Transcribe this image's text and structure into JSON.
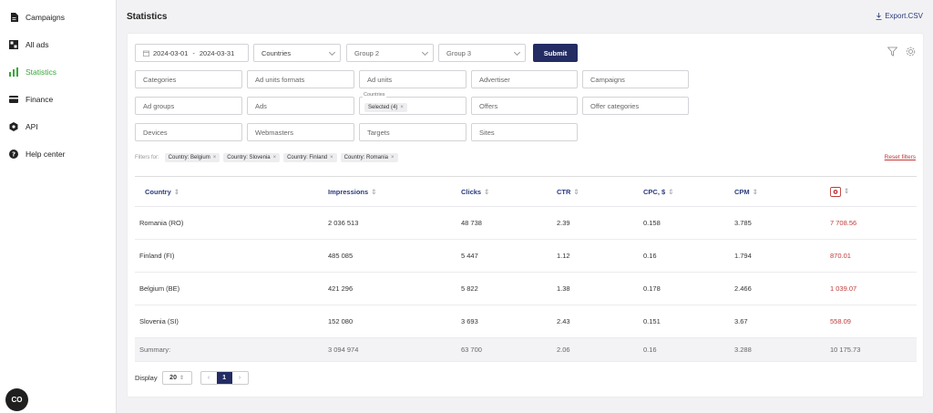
{
  "sidebar": {
    "items": [
      {
        "label": "Campaigns",
        "icon": "document-icon"
      },
      {
        "label": "All ads",
        "icon": "grid-icon"
      },
      {
        "label": "Statistics",
        "icon": "bar-chart-icon",
        "active": true
      },
      {
        "label": "Finance",
        "icon": "card-icon"
      },
      {
        "label": "API",
        "icon": "hexagon-icon"
      },
      {
        "label": "Help center",
        "icon": "question-icon"
      }
    ],
    "chat_label": "CO"
  },
  "header": {
    "title": "Statistics",
    "export_label": "Export.CSV"
  },
  "filters": {
    "date_from": "2024-03-01",
    "date_sep": "-",
    "date_to": "2024-03-31",
    "group1": "Countries",
    "group2": "Group 2",
    "group3": "Group 3",
    "submit_label": "Submit",
    "categories": "Categories",
    "ad_unit_formats": "Ad units formats",
    "ad_units": "Ad units",
    "advertiser": "Advertiser",
    "campaigns": "Campaigns",
    "ad_groups": "Ad groups",
    "ads": "Ads",
    "countries_label": "Countries",
    "countries_value": "Selected (4)",
    "offers": "Offers",
    "offer_categories": "Offer categories",
    "devices": "Devices",
    "webmasters": "Webmasters",
    "targets": "Targets",
    "sites": "Sites"
  },
  "active_filters": {
    "label": "Filters for:",
    "chips": [
      "Country: Belgium",
      "Country: Slovenia",
      "Country: Finland",
      "Country: Romania"
    ],
    "reset_label": "Reset filters"
  },
  "table": {
    "headers": [
      "Country",
      "Impressions",
      "Clicks",
      "CTR",
      "CPC, $",
      "CPM",
      ""
    ],
    "rows": [
      [
        "Romania (RO)",
        "2 036 513",
        "48 738",
        "2.39",
        "0.158",
        "3.785",
        "7 708.56"
      ],
      [
        "Finland (FI)",
        "485 085",
        "5 447",
        "1.12",
        "0.16",
        "1.794",
        "870.01"
      ],
      [
        "Belgium (BE)",
        "421 296",
        "5 822",
        "1.38",
        "0.178",
        "2.466",
        "1 039.07"
      ],
      [
        "Slovenia (SI)",
        "152 080",
        "3 693",
        "2.43",
        "0.151",
        "3.67",
        "558.09"
      ]
    ],
    "summary": [
      "Summary:",
      "3 094 974",
      "63 700",
      "2.06",
      "0.16",
      "3.288",
      "10 175.73"
    ]
  },
  "pagination": {
    "display_label": "Display",
    "page_size": "20",
    "current_page": "1"
  },
  "colors": {
    "accent_green": "#3aa63a",
    "navy": "#232c63",
    "red": "#c03a3a"
  }
}
